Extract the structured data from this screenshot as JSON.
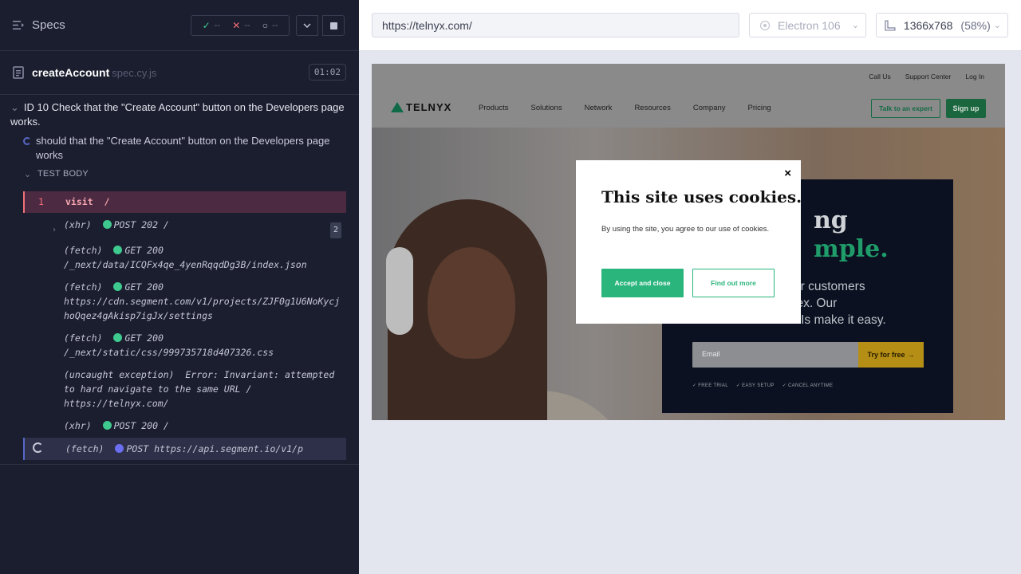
{
  "reporter": {
    "specs_label": "Specs",
    "stats": {
      "passed": "--",
      "failed": "--",
      "pending": "--"
    },
    "spec": {
      "name": "createAccount",
      "ext": "spec.cy.js",
      "duration": "01:02"
    },
    "suite_title": "ID 10 Check that the \"Create Account\" button on the Developers page works.",
    "test_title": "should that the \"Create Account\" button on the Developers page works",
    "test_body_label": "TEST BODY",
    "commands": [
      {
        "num": "1",
        "name": "visit",
        "msg": "/"
      },
      {
        "type": "(xhr)",
        "method": "POST 202 /",
        "count": "2"
      },
      {
        "type": "(fetch)",
        "method": "GET 200",
        "url": "/_next/data/ICQFx4qe_4yenRqqdDg3B/index.json"
      },
      {
        "type": "(fetch)",
        "method": "GET 200",
        "url": "https://cdn.segment.com/v1/projects/ZJF0g1U6NoKycjhoQqez4gAkisp7igJx/settings"
      },
      {
        "type": "(fetch)",
        "method": "GET 200",
        "url": "/_next/static/css/999735718d407326.css"
      },
      {
        "type": "(uncaught exception)",
        "method": "Error: Invariant: attempted to hard navigate to the same URL / https://telnyx.com/"
      },
      {
        "type": "(xhr)",
        "method": "POST 200 /"
      },
      {
        "type": "(fetch)",
        "method": "POST https://api.segment.io/v1/p"
      }
    ]
  },
  "app": {
    "url": "https://telnyx.com/",
    "browser": "Electron 106",
    "viewport": "1366x768",
    "scale": "(58%)"
  },
  "site": {
    "util_links": [
      "Call Us",
      "Support Center",
      "Log In"
    ],
    "logo": "TELNYX",
    "nav": [
      "Products",
      "Solutions",
      "Network",
      "Resources",
      "Company",
      "Pricing"
    ],
    "talk_button": "Talk to an expert",
    "signup_button": "Sign up",
    "hero_line1": "ng",
    "hero_line2": "mple.",
    "hero_sub": [
      "ur customers",
      "lex. Our",
      "communications APIs make it easy."
    ],
    "email_placeholder": "Email",
    "try_button": "Try for free",
    "perks": [
      "✓ FREE TRIAL",
      "✓ EASY SETUP",
      "✓ CANCEL ANYTIME"
    ]
  },
  "cookie": {
    "close": "×",
    "title": "This site uses cookies.",
    "text": "By using the site, you agree to our use of cookies.",
    "accept": "Accept and close",
    "more": "Find out more"
  }
}
